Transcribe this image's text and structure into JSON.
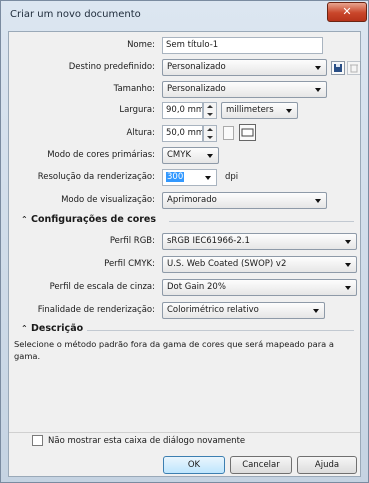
{
  "window": {
    "title": "Criar um novo documento",
    "close_glyph": "✕"
  },
  "form": {
    "nome": {
      "label": "Nome:",
      "value": "Sem título-1"
    },
    "destino": {
      "label": "Destino predefinido:",
      "value": "Personalizado"
    },
    "tamanho": {
      "label": "Tamanho:",
      "value": "Personalizado"
    },
    "largura": {
      "label": "Largura:",
      "value": "90,0 mm",
      "unit": "millimeters"
    },
    "altura": {
      "label": "Altura:",
      "value": "50,0 mm"
    },
    "modo_cores": {
      "label": "Modo de cores primárias:",
      "value": "CMYK"
    },
    "resolucao": {
      "label": "Resolução da renderização:",
      "value": "300",
      "unit": "dpi"
    },
    "visualizacao": {
      "label": "Modo de visualização:",
      "value": "Aprimorado"
    }
  },
  "color_section": {
    "title": "Configurações de cores",
    "rgb": {
      "label": "Perfil RGB:",
      "value": "sRGB IEC61966-2.1"
    },
    "cmyk": {
      "label": "Perfil CMYK:",
      "value": "U.S. Web Coated (SWOP) v2"
    },
    "gray": {
      "label": "Perfil de escala de cinza:",
      "value": "Dot Gain 20%"
    },
    "intent": {
      "label": "Finalidade de renderização:",
      "value": "Colorimétrico relativo"
    }
  },
  "desc_section": {
    "title": "Descrição",
    "text": "Selecione o método padrão fora da gama de cores que será mapeado para a gama."
  },
  "footer": {
    "checkbox_label": "Não mostrar esta caixa de diálogo novamente",
    "ok": "OK",
    "cancel": "Cancelar",
    "help": "Ajuda"
  },
  "icons": [
    "save-icon",
    "delete-icon",
    "portrait-icon",
    "landscape-icon",
    "collapse-icon"
  ]
}
